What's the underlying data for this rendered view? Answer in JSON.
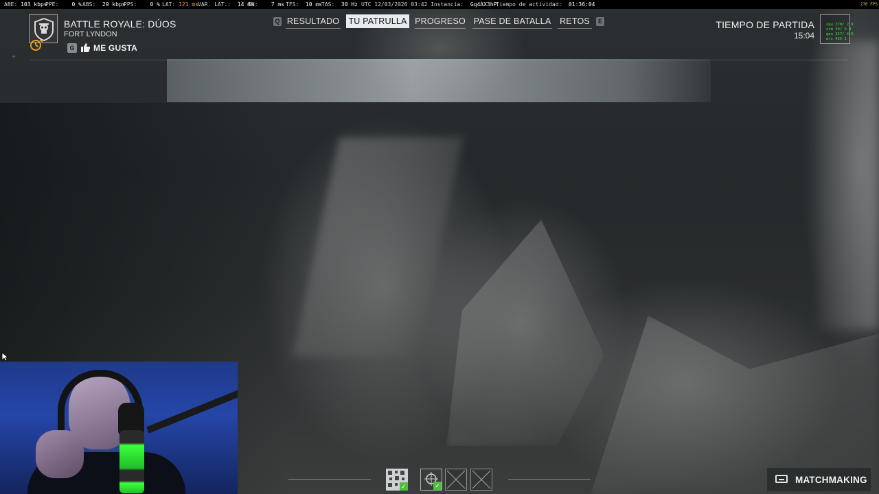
{
  "stats": {
    "abe_label": "ABE:",
    "abe_value": "103 kbps",
    "ppe_label": "PPE:",
    "ppe_value": "0 %",
    "abs_label": "ABS:",
    "abs_value": "29 kbps",
    "pps_label": "PPS:",
    "pps_value": "0 %",
    "lat_label": "LAT:",
    "lat_value": "121 ms",
    "varlat_label": "VAR. LAT.:",
    "varlat_value": "14 ms",
    "tn_label": "TN:",
    "tn_value": "7 ms",
    "tfs_label": "TFS:",
    "tfs_value": "10 ms",
    "tas_label": "TAS:",
    "tas_value": "30 Hz",
    "utc_text": "UTC 12/03/2026 03:42",
    "instance_label": "Instancia:",
    "instance_value": "Gq4AX3hP",
    "uptime_label": "Tiempo de actividad:",
    "uptime_value": "01:36:04",
    "fps": "270 FPS"
  },
  "game": {
    "title": "BATTLE ROYALE: DÚOS",
    "map": "FORT LYNDON",
    "like_key": "G",
    "like_label": "ME GUSTA"
  },
  "tabs": {
    "prev_key": "Q",
    "next_key": "E",
    "items": [
      {
        "label": "RESULTADO",
        "active": false
      },
      {
        "label": "TU PATRULLA",
        "active": true
      },
      {
        "label": "PROGRESO",
        "active": false
      },
      {
        "label": "PASE DE BATALLA",
        "active": false
      },
      {
        "label": "RETOS",
        "active": false
      }
    ]
  },
  "match": {
    "label": "TIEMPO DE PARTIDA",
    "time": "15:04"
  },
  "perf": {
    "line1": "cpu 270/ 2.9",
    "line2": "sim  30/ 6.8",
    "line3": "gpu 257/ 4.5",
    "line4": "m/s 435 1"
  },
  "bottom": {
    "matchmaking_label": "MATCHMAKING"
  },
  "colors": {
    "accent_check": "#4fbf40",
    "lat_warn": "#f0a040",
    "perf_text": "#39e04a",
    "tab_active_bg": "#e9ecee"
  }
}
